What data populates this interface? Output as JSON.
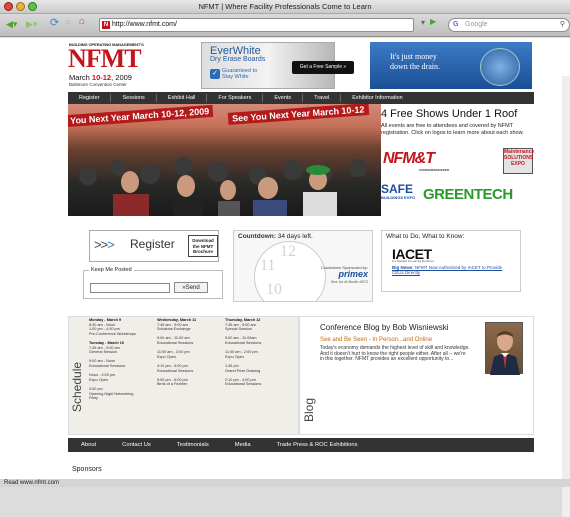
{
  "window": {
    "title": "NFMT | Where Facility Professionals Come to Learn"
  },
  "toolbar": {
    "url": "http://www.nfmt.com/",
    "favicon_letter": "N",
    "search_placeholder": "Google",
    "status_url": "Read www.nfmt.com"
  },
  "logo": {
    "top": "BUILDING OPERATING MANAGEMENT'S",
    "name": "NFMT",
    "date_pre": "March ",
    "date_days": "10-12",
    "date_year": ", 2009",
    "venue": "Baltimore Convention Center"
  },
  "ad_everwhite": {
    "title": "EverWhite",
    "subtitle": "Dry Erase Boards",
    "check_text": "Guaranteed to Stay White",
    "cta": "Get a Free Sample »"
  },
  "ad_money": {
    "text1": "It's just money",
    "text2": "down the drain."
  },
  "nav": [
    "Register",
    "Sessions",
    "Exhibit Hall",
    "For Speakers",
    "Events",
    "Travel",
    "Exhibitor Information"
  ],
  "hero": {
    "banner1": "You Next Year",
    "banner2": "March 10-12, 2009",
    "banner3": "See You Next Year",
    "banner4": "March 10-12"
  },
  "shows": {
    "heading": "4 Free Shows Under 1 Roof",
    "text": "All events are free to attendees and covered by NFMT registration. Click on logos to learn more about each show.",
    "b1": "NFM&T",
    "b1_sub": "CONFERENCE/EXPO",
    "b2": "Maintenance SOLUTIONS EXPO",
    "b3": "SAFE",
    "b3_sub": "BUILDINGS EXPO",
    "b4": "GREENTECH"
  },
  "register": {
    "label": "Register",
    "brochure": "Download the NFMT Brochure"
  },
  "keep_posted": {
    "legend": "Keep Me Posted",
    "send": "»Send"
  },
  "countdown": {
    "label": "Countdown:",
    "value": "34 days left.",
    "sponsored": "Countdown Sponsored by:",
    "sponsor": "primex",
    "booth": "See Us at Booth #572"
  },
  "know": {
    "label": "What to Do, What to Know:",
    "logo": "IACET",
    "logo_sub": "The Standard for Learning Excellence",
    "news_bold": "Big News:",
    "news": "NFMT Now Authorized by IACET to Provide CEUs Directly"
  },
  "schedule": {
    "label": "Schedule",
    "columns": [
      {
        "lines": [
          {
            "b": "Monday - March 9"
          },
          {
            "t": "8:30 am - Noon"
          },
          {
            "t": "1:00 pm - 4:30 pm"
          },
          {
            "t": "Pre-Conference Workshops"
          },
          {
            "t": ""
          },
          {
            "b": "Tuesday - March 10"
          },
          {
            "t": "7:45 am - 9:00 am"
          },
          {
            "t": "General Session"
          },
          {
            "t": ""
          },
          {
            "t": "9:00 am - Noon"
          },
          {
            "t": "Educational Sessions"
          },
          {
            "t": ""
          },
          {
            "t": "Noon - 4:00 pm"
          },
          {
            "t": "Expo Open"
          },
          {
            "t": ""
          },
          {
            "t": "4:00 pm"
          },
          {
            "t": "Opening Night Networking"
          },
          {
            "t": "Party"
          }
        ]
      },
      {
        "lines": [
          {
            "b": "Wednesday, March 11"
          },
          {
            "t": "7:45 am - 9:00 am"
          },
          {
            "t": "Solutions Exchange"
          },
          {
            "t": ""
          },
          {
            "t": "9:00 am - 11:00 am"
          },
          {
            "t": "Educational Sessions"
          },
          {
            "t": ""
          },
          {
            "t": "11:00 am - 3:00 pm"
          },
          {
            "t": "Expo Open"
          },
          {
            "t": ""
          },
          {
            "t": "3:10 pm - 5:00 pm"
          },
          {
            "t": "Educational Sessions"
          },
          {
            "t": ""
          },
          {
            "t": "5:00 pm - 6:00 pm"
          },
          {
            "t": "Birds of a Feather"
          }
        ]
      },
      {
        "lines": [
          {
            "b": "Thursday, March 12"
          },
          {
            "t": "7:45 am - 9:00 am"
          },
          {
            "t": "Special Session"
          },
          {
            "t": ""
          },
          {
            "t": "9:00 am - 11:00am"
          },
          {
            "t": "Educational Sessions"
          },
          {
            "t": ""
          },
          {
            "t": "11:00 am - 2:00 pm"
          },
          {
            "t": "Expo Open"
          },
          {
            "t": ""
          },
          {
            "t": "1:45 pm"
          },
          {
            "t": "Grand Prize Drawing"
          },
          {
            "t": ""
          },
          {
            "t": "2:10 pm - 4:00 pm"
          },
          {
            "t": "Educational Sessions"
          }
        ]
      }
    ]
  },
  "blog": {
    "label": "Blog",
    "title": "Conference Blog by Bob Wisniewski",
    "subtitle": "See and Be Seen - In Person...and Online",
    "body": "Today's economy demands the highest level of skill and knowledge. And it doesn't hurt to know the right people either. After all -- we're in this together. NFMT provides an excellent opportunity to..."
  },
  "footer": [
    "About",
    "Contact Us",
    "Testimonials",
    "Media",
    "Trade Press & ROC Exhibitions"
  ],
  "sponsors": {
    "label": "Sponsors"
  }
}
